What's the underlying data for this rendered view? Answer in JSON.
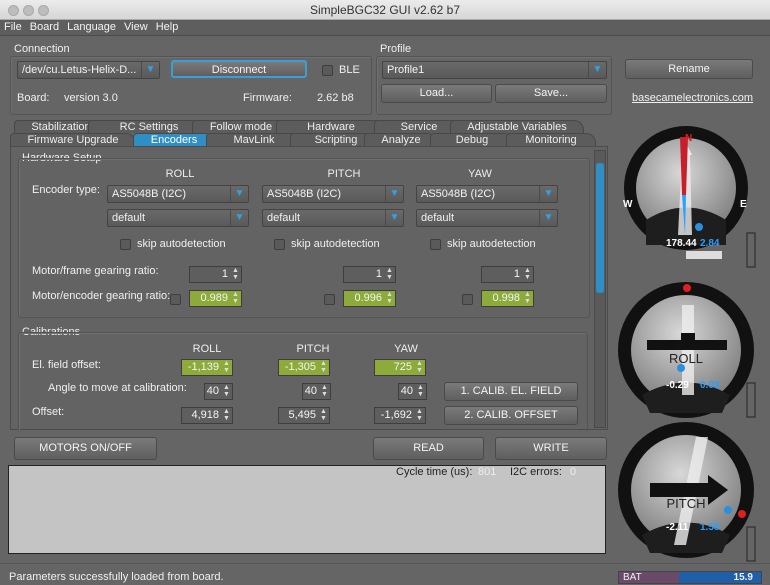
{
  "window": {
    "title": "SimpleBGC32 GUI v2.62 b7"
  },
  "menu": [
    "File",
    "Board",
    "Language",
    "View",
    "Help"
  ],
  "connection": {
    "label": "Connection",
    "port": "/dev/cu.Letus-Helix-D...",
    "disconnect": "Disconnect",
    "ble": "BLE",
    "board_label": "Board:",
    "board_value": "version 3.0",
    "firmware_label": "Firmware:",
    "firmware_value": "2.62 b8"
  },
  "profile": {
    "label": "Profile",
    "selected": "Profile1",
    "load": "Load...",
    "save": "Save...",
    "rename": "Rename",
    "link": "basecamelectronics.com"
  },
  "tabs_row1": [
    "Stabilization",
    "RC Settings",
    "Follow mode",
    "Hardware",
    "Service",
    "Adjustable Variables"
  ],
  "tabs_row2": [
    "Firmware Upgrade",
    "Encoders",
    "MavLink",
    "Scripting",
    "Analyze",
    "Debug",
    "Monitoring"
  ],
  "active_tab": "Encoders",
  "hardware": {
    "title": "Hardware Setup",
    "axes": [
      "ROLL",
      "PITCH",
      "YAW"
    ],
    "encoder_type_label": "Encoder type:",
    "encoder_types": [
      "AS5048B (I2C)",
      "AS5048B (I2C)",
      "AS5048B (I2C)"
    ],
    "configs": [
      "default",
      "default",
      "default"
    ],
    "skip_label": "skip autodetection",
    "motor_frame_label": "Motor/frame gearing ratio:",
    "motor_frame": [
      "1",
      "1",
      "1"
    ],
    "motor_encoder_label": "Motor/encoder gearing ratio:",
    "motor_encoder": [
      "0.989",
      "0.996",
      "0.998"
    ]
  },
  "calibrations": {
    "title": "Calibrations",
    "axes": [
      "ROLL",
      "PITCH",
      "YAW"
    ],
    "el_field_label": "El. field offset:",
    "el_field": [
      "-1,139",
      "-1,305",
      "725"
    ],
    "angle_label": "Angle to move at calibration:",
    "angle": [
      "40",
      "40",
      "40"
    ],
    "offset_label": "Offset:",
    "offset": [
      "4,918",
      "5,495",
      "-1,692"
    ],
    "calib_el_field": "1. CALIB. EL. FIELD",
    "calib_offset": "2. CALIB. OFFSET"
  },
  "buttons": {
    "motors": "MOTORS ON/OFF",
    "read": "READ",
    "write": "WRITE"
  },
  "log": {
    "cycle_label": "Cycle time (us):",
    "cycle_value": "801",
    "i2c_label": "I2C errors:",
    "i2c_value": "0"
  },
  "status": "Parameters successfully loaded from board.",
  "gauges": {
    "yaw": {
      "compass": [
        "N",
        "E",
        "W"
      ],
      "angle": "178.44",
      "rate": "2.84"
    },
    "roll": {
      "label": "ROLL",
      "angle": "-0.29",
      "rate": "0.03"
    },
    "pitch": {
      "label": "PITCH",
      "angle": "-2.11",
      "rate": "1.58"
    }
  },
  "battery": {
    "label": "BAT",
    "value": "15.9"
  },
  "colors": {
    "accent": "#2f8fc4",
    "green_field": "#8cab3a",
    "rate_blue": "#2aa0ff"
  }
}
